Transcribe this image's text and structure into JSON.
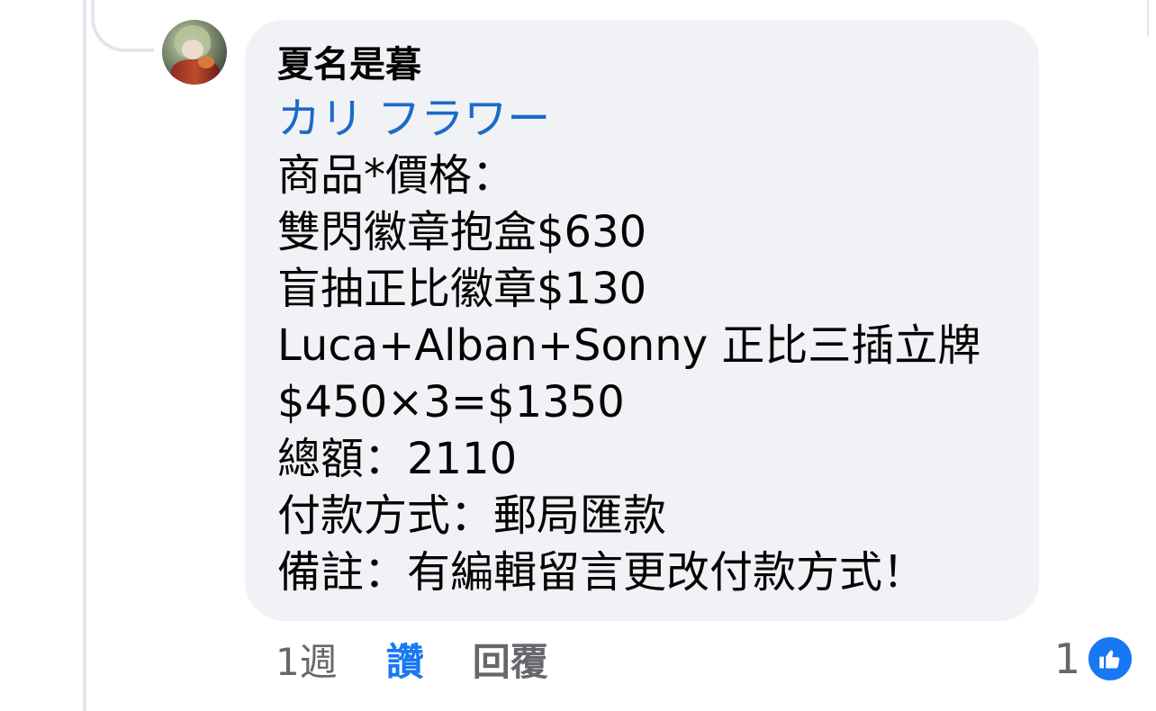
{
  "comment": {
    "author": "夏名是暮",
    "mention": "カリ フラワー",
    "lines": [
      "商品*價格：",
      "雙閃徽章抱盒$630",
      "盲抽正比徽章$130",
      "Luca+Alban+Sonny 正比三插立牌",
      "$450×3=$1350",
      "總額：2110",
      "付款方式：郵局匯款",
      "備註：有編輯留言更改付款方式！"
    ]
  },
  "actions": {
    "time": "1週",
    "like_label": "讚",
    "reply_label": "回覆"
  },
  "reactions": {
    "count": "1",
    "icon": "thumbs-up-icon"
  },
  "colors": {
    "bubble": "#f0f2f5",
    "mention": "#1b6ac9",
    "like_active": "#1877f2",
    "meta_text": "#65676b"
  }
}
